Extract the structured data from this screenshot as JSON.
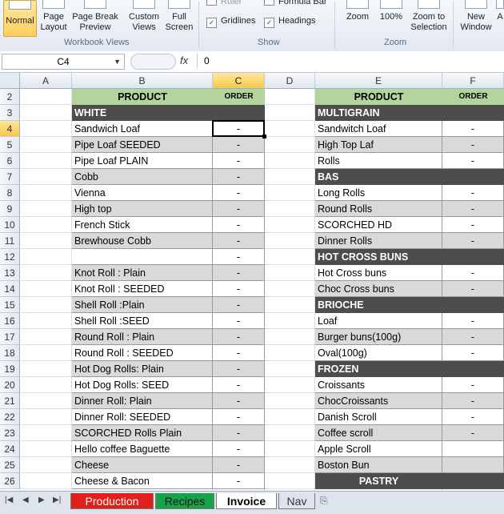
{
  "ribbon": {
    "normal": "Normal",
    "page_layout": [
      "Page",
      "Layout"
    ],
    "page_break": [
      "Page Break",
      "Preview"
    ],
    "custom_views": [
      "Custom",
      "Views"
    ],
    "full_screen": [
      "Full",
      "Screen"
    ],
    "group_workbook_views": "Workbook Views",
    "ruler": "Ruler",
    "formula_bar": "Formula Bar",
    "gridlines": "Gridlines",
    "headings": "Headings",
    "group_show": "Show",
    "zoom": "Zoom",
    "zoom_100": "100%",
    "zoom_selection": [
      "Zoom to",
      "Selection"
    ],
    "group_zoom": "Zoom",
    "new_window": [
      "New",
      "Window"
    ],
    "arrange": "A"
  },
  "formula_bar": {
    "name_box": "C4",
    "fx": "fx",
    "value": "0"
  },
  "columns": [
    "A",
    "B",
    "C",
    "D",
    "E",
    "F"
  ],
  "rows": [
    "2",
    "3",
    "4",
    "5",
    "6",
    "7",
    "8",
    "9",
    "10",
    "11",
    "12",
    "13",
    "14",
    "15",
    "16",
    "17",
    "18",
    "19",
    "20",
    "21",
    "22",
    "23",
    "24",
    "25",
    "26"
  ],
  "left_table": {
    "product_header": "PRODUCT",
    "order_header": "ORDER",
    "section": "WHITE",
    "items": [
      {
        "name": "Sandwich Loaf",
        "order": "-"
      },
      {
        "name": "Pipe Loaf SEEDED",
        "order": "-"
      },
      {
        "name": "Pipe Loaf PLAIN",
        "order": "-"
      },
      {
        "name": "Cobb",
        "order": "-"
      },
      {
        "name": "Vienna",
        "order": "-"
      },
      {
        "name": "High top",
        "order": "-"
      },
      {
        "name": "French Stick",
        "order": "-"
      },
      {
        "name": "Brewhouse Cobb",
        "order": "-"
      },
      {
        "name": "",
        "order": "-"
      },
      {
        "name": "Knot Roll  : Plain",
        "order": "-"
      },
      {
        "name": "Knot Roll  :  SEEDED",
        "order": "-"
      },
      {
        "name": "Shell Roll :Plain",
        "order": "-"
      },
      {
        "name": "Shell Roll :SEED",
        "order": "-"
      },
      {
        "name": "Round Roll  : Plain",
        "order": "-"
      },
      {
        "name": "Round Roll  : SEEDED",
        "order": "-"
      },
      {
        "name": "Hot Dog Rolls: Plain",
        "order": "-"
      },
      {
        "name": "Hot Dog Rolls: SEED",
        "order": "-"
      },
      {
        "name": "Dinner Roll: Plain",
        "order": "-"
      },
      {
        "name": "Dinner Roll: SEEDED",
        "order": "-"
      },
      {
        "name": "SCORCHED Rolls Plain",
        "order": "-"
      },
      {
        "name": "Hello coffee Baguette",
        "order": "-"
      },
      {
        "name": "Cheese",
        "order": "-"
      },
      {
        "name": "Cheese & Bacon",
        "order": "-"
      }
    ]
  },
  "right_table": {
    "product_header": "PRODUCT",
    "order_header": "ORDER",
    "rows": [
      {
        "kind": "section",
        "name": "MULTIGRAIN"
      },
      {
        "kind": "item",
        "name": "Sandwitch Loaf",
        "order": "-"
      },
      {
        "kind": "item",
        "name": "High Top Laf",
        "order": "-"
      },
      {
        "kind": "item",
        "name": "Rolls",
        "order": "-"
      },
      {
        "kind": "section",
        "name": "BAS"
      },
      {
        "kind": "item",
        "name": "Long Rolls",
        "order": "-"
      },
      {
        "kind": "item",
        "name": "Round Rolls",
        "order": "-"
      },
      {
        "kind": "item",
        "name": "SCORCHED HD",
        "order": "-"
      },
      {
        "kind": "item",
        "name": "Dinner Rolls",
        "order": "-"
      },
      {
        "kind": "section",
        "name": "HOT CROSS BUNS"
      },
      {
        "kind": "item",
        "name": "Hot Cross buns",
        "order": "-"
      },
      {
        "kind": "item",
        "name": "Choc Cross buns",
        "order": "-"
      },
      {
        "kind": "section",
        "name": "BRIOCHE"
      },
      {
        "kind": "item",
        "name": "Loaf",
        "order": "-"
      },
      {
        "kind": "item",
        "name": "Burger buns(100g)",
        "order": "-"
      },
      {
        "kind": "item",
        "name": "Oval(100g)",
        "order": "-"
      },
      {
        "kind": "section",
        "name": "FROZEN"
      },
      {
        "kind": "item",
        "name": "Croissants",
        "order": "-"
      },
      {
        "kind": "item",
        "name": "ChocCroissants",
        "order": "-"
      },
      {
        "kind": "item",
        "name": "Danish Scroll",
        "order": "-"
      },
      {
        "kind": "item",
        "name": "Coffee scroll",
        "order": "-"
      },
      {
        "kind": "item",
        "name": "Apple Scroll",
        "order": ""
      },
      {
        "kind": "item",
        "name": "Boston Bun",
        "order": ""
      },
      {
        "kind": "section-center",
        "name": "PASTRY"
      }
    ]
  },
  "tabs": [
    {
      "label": "Production",
      "color": "#e0211b"
    },
    {
      "label": "Recipes",
      "color": "#16a34a"
    },
    {
      "label": "Invoice",
      "color": "#ffffff"
    },
    {
      "label": "Nav",
      "color": "#dde4ee"
    }
  ]
}
